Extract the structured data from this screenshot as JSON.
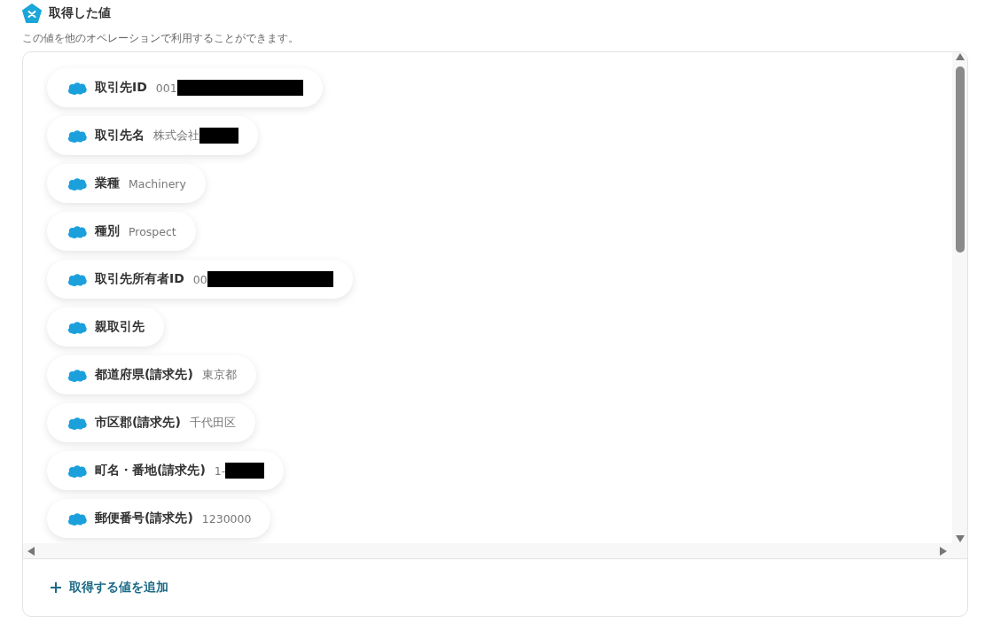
{
  "header": {
    "title": "取得した値",
    "subtitle": "この値を他のオペレーションで利用することができます。"
  },
  "values": [
    {
      "label": "取引先ID",
      "value": "001",
      "kind": "redacted_long"
    },
    {
      "label": "取引先名",
      "value": "株式会社",
      "kind": "redacted_short"
    },
    {
      "label": "業種",
      "value": "Machinery",
      "kind": "plain"
    },
    {
      "label": "種別",
      "value": "Prospect",
      "kind": "plain"
    },
    {
      "label": "取引先所有者ID",
      "value": "00",
      "kind": "redacted_long"
    },
    {
      "label": "親取引先"
    },
    {
      "label": "都道府県(請求先)",
      "value": "東京都",
      "kind": "plain"
    },
    {
      "label": "市区郡(請求先)",
      "value": "千代田区",
      "kind": "plain"
    },
    {
      "label": "町名・番地(請求先)",
      "value": "1-",
      "kind": "redacted_short"
    },
    {
      "label": "郵便番号(請求先)",
      "value": "1230000",
      "kind": "plain"
    }
  ],
  "add_button": {
    "label": "取得する値を追加"
  }
}
